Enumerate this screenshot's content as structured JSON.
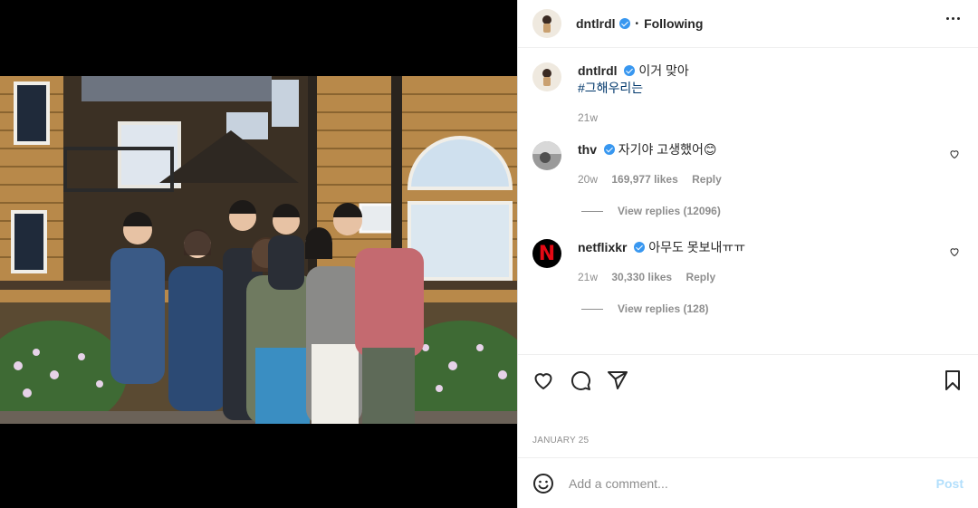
{
  "post": {
    "author": "dntlrdl",
    "following_label": "Following",
    "separator": "•",
    "more_icon": "more-horizontal-icon"
  },
  "caption": {
    "username": "dntlrdl",
    "text": "이거 맞아",
    "hashtag": "#그해우리는",
    "time": "21w"
  },
  "comments": [
    {
      "username": "thv",
      "text": "자기야 고생했어😊",
      "time": "20w",
      "likes": "169,977 likes",
      "reply_label": "Reply",
      "view_replies": "View replies (12096)"
    },
    {
      "username": "netflixkr",
      "avatar_letter": "N",
      "text": "아무도 못보내ㅠㅠ",
      "time": "21w",
      "likes": "30,330 likes",
      "reply_label": "Reply",
      "view_replies": "View replies (128)"
    }
  ],
  "actions": {
    "like_icon": "heart-icon",
    "comment_icon": "comment-icon",
    "share_icon": "send-icon",
    "save_icon": "bookmark-icon"
  },
  "date": "JANUARY 25",
  "add_comment": {
    "placeholder": "Add a comment...",
    "post_label": "Post"
  },
  "colors": {
    "verified": "#3897f0",
    "link": "#00376b",
    "muted": "#8e8e8e",
    "post_disabled": "#b2dffc",
    "netflix_red": "#e50914"
  }
}
